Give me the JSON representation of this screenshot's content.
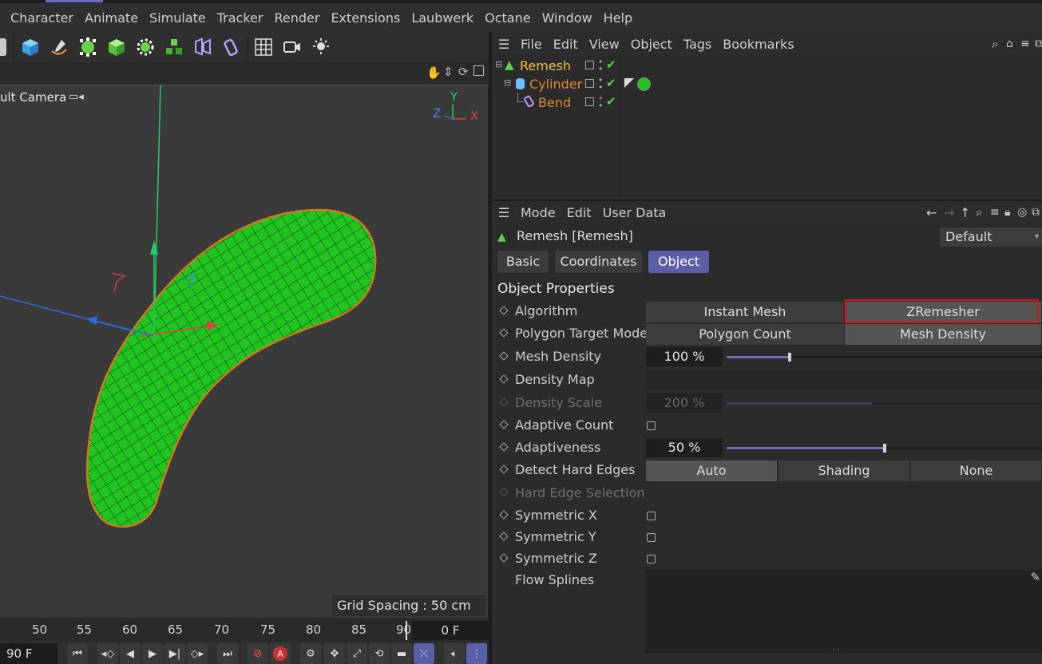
{
  "menu": [
    "Character",
    "Animate",
    "Simulate",
    "Tracker",
    "Render",
    "Extensions",
    "Laubwerk",
    "Octane",
    "Window",
    "Help"
  ],
  "viewport": {
    "camera_label": "ult Camera",
    "grid_spacing": "Grid Spacing : 50 cm",
    "axis_labels": {
      "y": "Y",
      "z": "Z",
      "x": "X"
    }
  },
  "timeline": {
    "ticks": [
      "50",
      "55",
      "60",
      "65",
      "70",
      "75",
      "80",
      "85",
      "90"
    ],
    "frame_field": "0 F",
    "current_frame": "90 F"
  },
  "object_manager": {
    "menu": [
      "File",
      "Edit",
      "View",
      "Object",
      "Tags",
      "Bookmarks"
    ],
    "objects": [
      {
        "name": "Remesh",
        "color": "#f0c040"
      },
      {
        "name": "Cylinder",
        "color": "#e08a2a"
      },
      {
        "name": "Bend",
        "color": "#e08a2a"
      }
    ]
  },
  "attributes": {
    "menu": [
      "Mode",
      "Edit",
      "User Data"
    ],
    "title": "Remesh [Remesh]",
    "preset": "Default",
    "tabs": [
      "Basic",
      "Coordinates",
      "Object"
    ],
    "active_tab": "Object",
    "section": "Object Properties",
    "algorithm": {
      "label": "Algorithm",
      "options": [
        "Instant Mesh",
        "ZRemesher"
      ],
      "selected": "ZRemesher"
    },
    "polygon_target_mode": {
      "label": "Polygon Target Mode",
      "options": [
        "Polygon Count",
        "Mesh Density"
      ],
      "selected": "Mesh Density"
    },
    "mesh_density": {
      "label": "Mesh Density",
      "value": "100 %",
      "fraction": 0.2
    },
    "density_map": {
      "label": "Density Map"
    },
    "density_scale": {
      "label": "Density Scale",
      "value": "200 %",
      "fraction": 0.46,
      "enabled": false
    },
    "adaptive_count": {
      "label": "Adaptive Count",
      "checked": false
    },
    "adaptiveness": {
      "label": "Adaptiveness",
      "value": "50 %",
      "fraction": 0.5
    },
    "detect_hard_edges": {
      "label": "Detect Hard Edges",
      "options": [
        "Auto",
        "Shading",
        "None"
      ],
      "selected": "Auto"
    },
    "hard_edge_selection": {
      "label": "Hard Edge Selection",
      "enabled": false
    },
    "symmetric_x": {
      "label": "Symmetric X",
      "checked": false
    },
    "symmetric_y": {
      "label": "Symmetric Y",
      "checked": false
    },
    "symmetric_z": {
      "label": "Symmetric Z",
      "checked": false
    },
    "flow_splines": {
      "label": "Flow Splines"
    }
  },
  "colors": {
    "accent": "#5b5fa8",
    "highlight": "#e01010",
    "mesh": "#22c422",
    "outline": "#d07a20"
  }
}
